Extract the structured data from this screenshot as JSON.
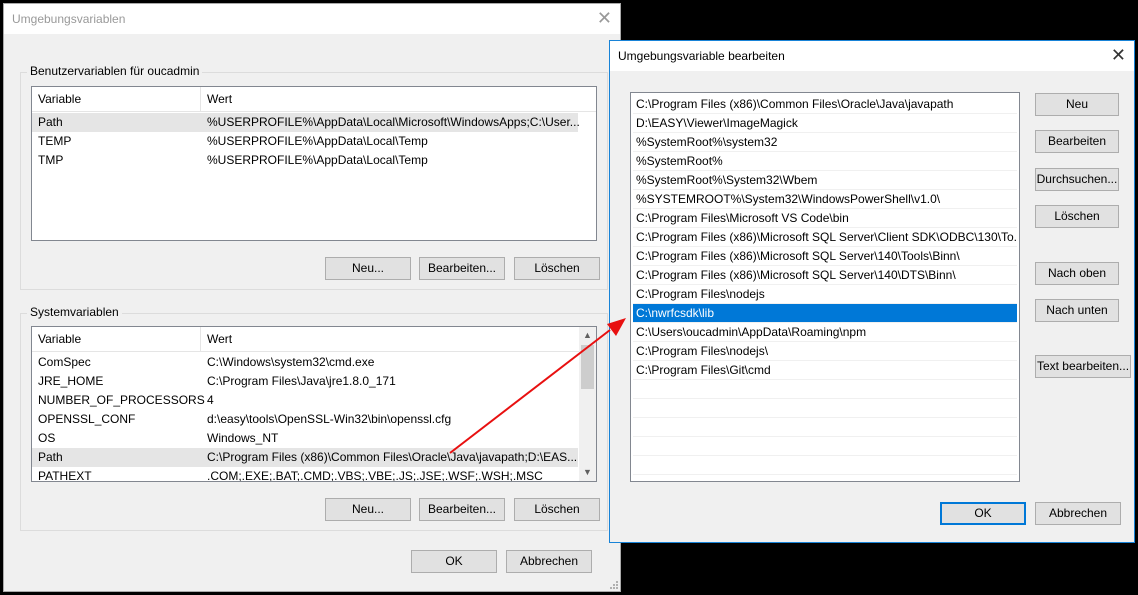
{
  "main_window": {
    "title": "Umgebungsvariablen",
    "user_group": {
      "label": "Benutzervariablen für oucadmin",
      "columns": [
        "Variable",
        "Wert"
      ],
      "rows": [
        {
          "variable": "Path",
          "value": "%USERPROFILE%\\AppData\\Local\\Microsoft\\WindowsApps;C:\\User..."
        },
        {
          "variable": "TEMP",
          "value": "%USERPROFILE%\\AppData\\Local\\Temp"
        },
        {
          "variable": "TMP",
          "value": "%USERPROFILE%\\AppData\\Local\\Temp"
        }
      ],
      "buttons": {
        "new": "Neu...",
        "edit": "Bearbeiten...",
        "delete": "Löschen"
      }
    },
    "system_group": {
      "label": "Systemvariablen",
      "columns": [
        "Variable",
        "Wert"
      ],
      "rows": [
        {
          "variable": "ComSpec",
          "value": "C:\\Windows\\system32\\cmd.exe"
        },
        {
          "variable": "JRE_HOME",
          "value": "C:\\Program Files\\Java\\jre1.8.0_171"
        },
        {
          "variable": "NUMBER_OF_PROCESSORS",
          "value": "4"
        },
        {
          "variable": "OPENSSL_CONF",
          "value": "d:\\easy\\tools\\OpenSSL-Win32\\bin\\openssl.cfg"
        },
        {
          "variable": "OS",
          "value": "Windows_NT"
        },
        {
          "variable": "Path",
          "value": "C:\\Program Files (x86)\\Common Files\\Oracle\\Java\\javapath;D:\\EAS..."
        },
        {
          "variable": "PATHEXT",
          "value": ".COM;.EXE;.BAT;.CMD;.VBS;.VBE;.JS;.JSE;.WSF;.WSH;.MSC"
        }
      ],
      "buttons": {
        "new": "Neu...",
        "edit": "Bearbeiten...",
        "delete": "Löschen"
      }
    },
    "ok": "OK",
    "cancel": "Abbrechen"
  },
  "edit_dialog": {
    "title": "Umgebungsvariable bearbeiten",
    "entries": [
      "C:\\Program Files (x86)\\Common Files\\Oracle\\Java\\javapath",
      "D:\\EASY\\Viewer\\ImageMagick",
      "%SystemRoot%\\system32",
      "%SystemRoot%",
      "%SystemRoot%\\System32\\Wbem",
      "%SYSTEMROOT%\\System32\\WindowsPowerShell\\v1.0\\",
      "C:\\Program Files\\Microsoft VS Code\\bin",
      "C:\\Program Files (x86)\\Microsoft SQL Server\\Client SDK\\ODBC\\130\\To...",
      "C:\\Program Files (x86)\\Microsoft SQL Server\\140\\Tools\\Binn\\",
      "C:\\Program Files (x86)\\Microsoft SQL Server\\140\\DTS\\Binn\\",
      "C:\\Program Files\\nodejs",
      "C:\\nwrfcsdk\\lib",
      "C:\\Users\\oucadmin\\AppData\\Roaming\\npm",
      "C:\\Program Files\\nodejs\\",
      "C:\\Program Files\\Git\\cmd"
    ],
    "selected_index": 11,
    "buttons": {
      "new": "Neu",
      "edit": "Bearbeiten",
      "browse": "Durchsuchen...",
      "delete": "Löschen",
      "move_up": "Nach oben",
      "move_down": "Nach unten",
      "edit_text": "Text bearbeiten..."
    },
    "ok": "OK",
    "cancel": "Abbrechen"
  },
  "colors": {
    "selection": "#0078d7",
    "arrow": "#e81010"
  }
}
